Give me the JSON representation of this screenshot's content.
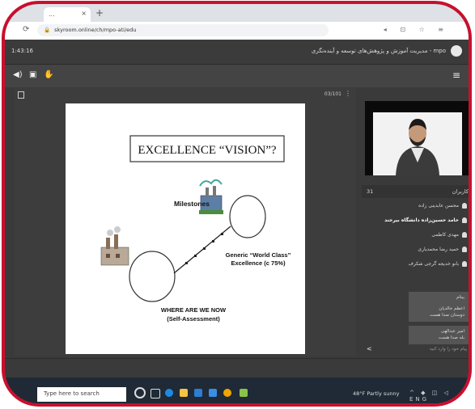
{
  "browser": {
    "tab_label": "...",
    "tab_close": "×",
    "new_tab": "+",
    "reload_icon": "⟳",
    "url": "skyroom.online/ch/mpo-ati/edu",
    "extension_icons": "◂ ⊡ ☆ ≡"
  },
  "app": {
    "timer": "1:43:16",
    "room_title": "mpo - مدیریت آموزش و پژوهش‌های توسعه و آینده‌نگری",
    "toolbar_icons": [
      "speaker-icon",
      "screen-share-icon",
      "raise-hand-icon"
    ],
    "menu_icon": "≡"
  },
  "presentation": {
    "page_indicator": "03/101",
    "slide": {
      "title": "EXCELLENCE “VISION”?",
      "milestones": "Milestones",
      "generic": "Generic “World Class”",
      "generic2": "Excellence (c 75%)",
      "where": "WHERE ARE WE NOW",
      "self": "(Self-Assessment)"
    }
  },
  "users": {
    "count": "31",
    "title": "کاربران",
    "list": [
      {
        "name": "محسن عابدینی زاده",
        "bold": false
      },
      {
        "name": "حامد حسین‌زاده دانشگاه بیرجند",
        "bold": true
      },
      {
        "name": "مهدی کاظمی",
        "bold": false
      },
      {
        "name": "حمید رضا محمدیاری",
        "bold": false
      },
      {
        "name": "بانو خدیجه گرجی شکرف",
        "bold": false
      }
    ]
  },
  "chat": {
    "messages": [
      {
        "author": "بیتام",
        "text": ""
      },
      {
        "author": "اعظم خالدیان",
        "text": "دوستان صدا هست"
      },
      {
        "author": "امیر عبدالهی",
        "text": "بله صدا هست"
      }
    ],
    "input_placeholder": "پیام خود را وارد کنید"
  },
  "taskbar": {
    "search_placeholder": "Type here to search",
    "weather": "48°F  Partly sunny",
    "sys_icons": "^ ◆ ◫ ◁ ENG"
  }
}
